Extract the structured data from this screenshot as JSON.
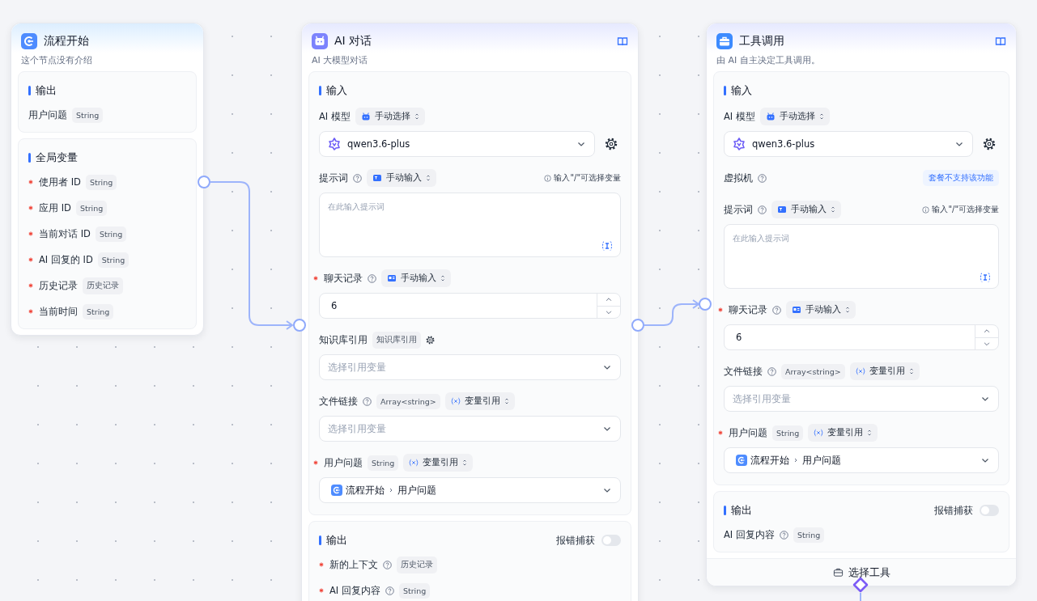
{
  "nodes": [
    {
      "kind": "start",
      "title": "流程开始",
      "description": "这个节点没有介绍",
      "docs": false,
      "sections": [
        {
          "title": "输出",
          "rows": [
            {
              "label": "用户问题",
              "required": false,
              "help": false,
              "type": "String"
            }
          ]
        },
        {
          "title": "全局变量",
          "rows": [
            {
              "label": "使用者 ID",
              "required": true,
              "help": false,
              "type": "String"
            },
            {
              "label": "应用 ID",
              "required": true,
              "help": false,
              "type": "String"
            },
            {
              "label": "当前对话 ID",
              "required": true,
              "help": false,
              "type": "String"
            },
            {
              "label": "AI 回复的 ID",
              "required": true,
              "help": false,
              "type": "String"
            },
            {
              "label": "历史记录",
              "required": true,
              "help": false,
              "type": "历史记录"
            },
            {
              "label": "当前时间",
              "required": true,
              "help": false,
              "type": "String"
            }
          ]
        }
      ]
    },
    {
      "kind": "chat",
      "title": "AI 对话",
      "description": "AI 大模型对话",
      "docs": true,
      "sections": [
        {
          "title": "输入",
          "fields": [
            {
              "label": "AI 模型",
              "required": false,
              "help": false,
              "tags": [
                {
                  "kind": "model",
                  "text": "手动选择"
                }
              ],
              "control": {
                "kind": "model",
                "value": "qwen3.6-plus"
              }
            },
            {
              "label": "提示词",
              "required": false,
              "help": true,
              "tags": [
                {
                  "kind": "text-input",
                  "text": "手动输入"
                }
              ],
              "hint": "输入\"/\"可选择变量",
              "control": {
                "kind": "textarea",
                "placeholder": "在此输入提示词"
              }
            },
            {
              "label": "聊天记录",
              "required": true,
              "help": true,
              "tags": [
                {
                  "kind": "card-input",
                  "text": "手动输入"
                }
              ],
              "control": {
                "kind": "number",
                "value": "6"
              }
            },
            {
              "label": "知识库引用",
              "required": false,
              "help": false,
              "tags": [
                {
                  "kind": "type",
                  "text": "知识库引用"
                }
              ],
              "gear": true,
              "control": {
                "kind": "select",
                "placeholder": "选择引用变量"
              }
            },
            {
              "label": "文件链接",
              "required": false,
              "help": true,
              "tags": [
                {
                  "kind": "type",
                  "text": "Array<string>"
                },
                {
                  "kind": "reference",
                  "text": "变量引用"
                }
              ],
              "control": {
                "kind": "select",
                "placeholder": "选择引用变量"
              }
            },
            {
              "label": "用户问题",
              "required": true,
              "help": false,
              "tags": [
                {
                  "kind": "type",
                  "text": "String"
                },
                {
                  "kind": "reference",
                  "text": "变量引用"
                }
              ],
              "control": {
                "kind": "ref",
                "source": "流程开始",
                "value": "用户问题"
              }
            }
          ]
        },
        {
          "title": "输出",
          "error_toggle": {
            "label": "报错捕获",
            "on": false
          },
          "rows": [
            {
              "label": "新的上下文",
              "required": true,
              "help": true,
              "type": "历史记录"
            },
            {
              "label": "AI 回复内容",
              "required": true,
              "help": true,
              "type": "String"
            }
          ]
        }
      ]
    },
    {
      "kind": "tools",
      "title": "工具调用",
      "description": "由 AI 自主决定工具调用。",
      "docs": true,
      "sections": [
        {
          "title": "输入",
          "fields": [
            {
              "label": "AI 模型",
              "required": false,
              "help": false,
              "tags": [
                {
                  "kind": "model",
                  "text": "手动选择"
                }
              ],
              "control": {
                "kind": "model",
                "value": "qwen3.6-plus"
              }
            },
            {
              "label": "虚拟机",
              "required": false,
              "help": true,
              "notice": "套餐不支持该功能"
            },
            {
              "label": "提示词",
              "required": false,
              "help": true,
              "tags": [
                {
                  "kind": "text-input",
                  "text": "手动输入"
                }
              ],
              "hint": "输入\"/\"可选择变量",
              "control": {
                "kind": "textarea",
                "placeholder": "在此输入提示词"
              }
            },
            {
              "label": "聊天记录",
              "required": true,
              "help": true,
              "tags": [
                {
                  "kind": "card-input",
                  "text": "手动输入"
                }
              ],
              "control": {
                "kind": "number",
                "value": "6"
              }
            },
            {
              "label": "文件链接",
              "required": false,
              "help": true,
              "tags": [
                {
                  "kind": "type",
                  "text": "Array<string>"
                },
                {
                  "kind": "reference",
                  "text": "变量引用"
                }
              ],
              "control": {
                "kind": "select",
                "placeholder": "选择引用变量"
              }
            },
            {
              "label": "用户问题",
              "required": true,
              "help": false,
              "tags": [
                {
                  "kind": "type",
                  "text": "String"
                },
                {
                  "kind": "reference",
                  "text": "变量引用"
                }
              ],
              "control": {
                "kind": "ref",
                "source": "流程开始",
                "value": "用户问题"
              }
            }
          ]
        },
        {
          "title": "输出",
          "error_toggle": {
            "label": "报错捕获",
            "on": false
          },
          "rows": [
            {
              "label": "AI 回复内容",
              "required": false,
              "help": true,
              "type": "String"
            }
          ]
        }
      ],
      "footer": {
        "label": "选择工具"
      }
    }
  ]
}
